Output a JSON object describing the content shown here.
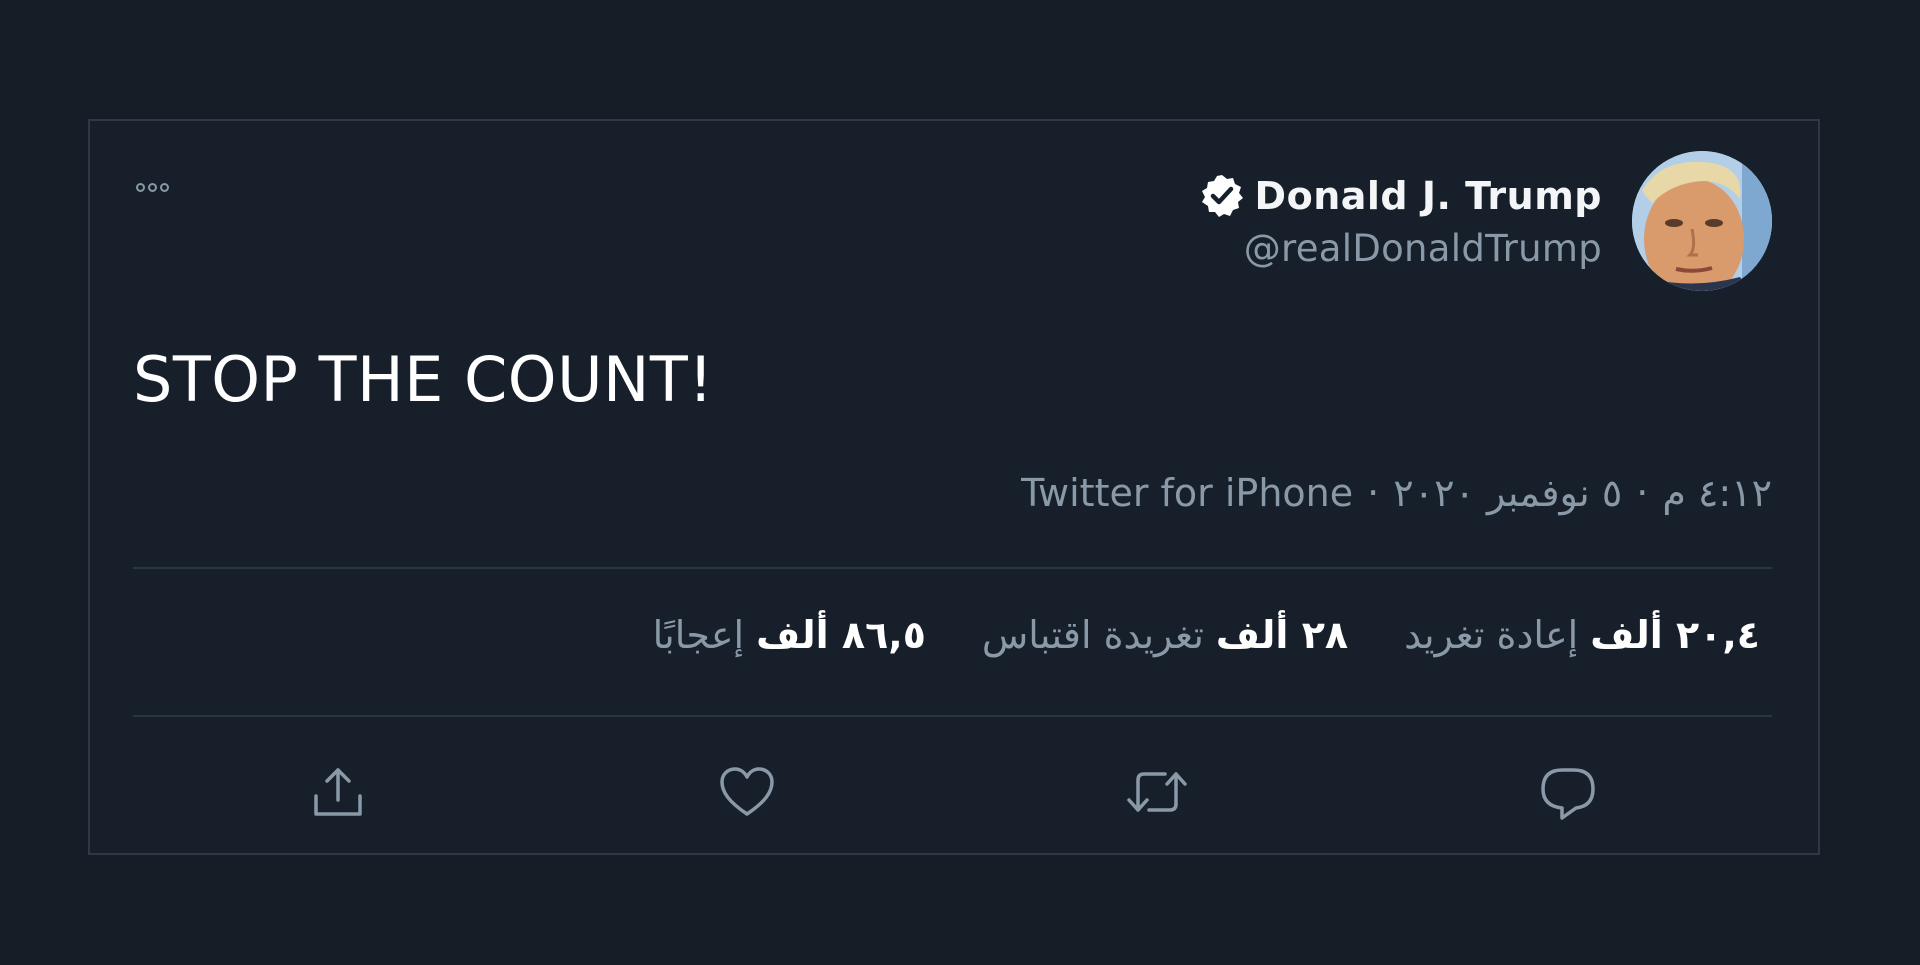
{
  "author": {
    "display_name": "Donald J. Trump",
    "handle": "@realDonaldTrump",
    "verified": true
  },
  "tweet": {
    "text": "STOP THE COUNT!"
  },
  "meta": {
    "time": "٤:١٢ م",
    "separator_1": "·",
    "date": "٥ نوفمبر ٢٠٢٠",
    "separator_2": "·",
    "source": "Twitter for iPhone"
  },
  "stats": [
    {
      "num": "٢٠,٤ ألف",
      "label": "إعادة تغريد"
    },
    {
      "num": "٢٨ ألف",
      "label": "تغريدة اقتباس"
    },
    {
      "num": "٨٦,٥ ألف",
      "label": "إعجابًا"
    }
  ],
  "icons": {
    "more": "more-icon",
    "verified": "verified-badge-icon",
    "reply": "reply-icon",
    "retweet": "retweet-icon",
    "like": "heart-icon",
    "share": "share-icon"
  },
  "colors": {
    "background": "#17202a",
    "text_primary": "#ffffff",
    "text_secondary": "#8a99a8",
    "divider": "#2c3640"
  }
}
